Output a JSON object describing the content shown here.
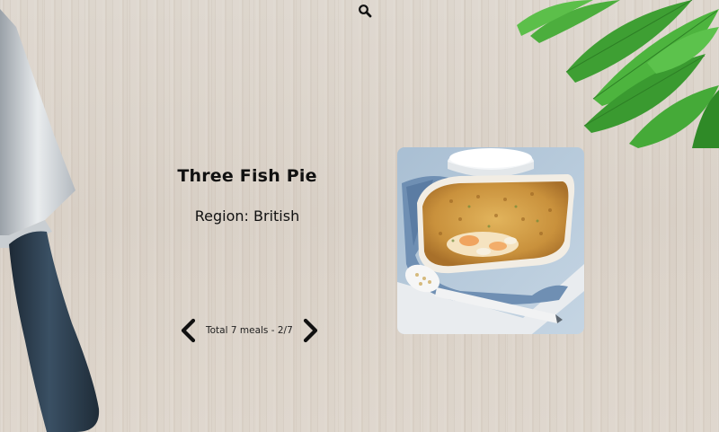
{
  "header": {
    "search_icon": "search-icon"
  },
  "meal": {
    "title": "Three Fish Pie",
    "region": "Region: British",
    "image": "three-fish-pie-photo"
  },
  "pager": {
    "text": "Total 7 meals - 2/7",
    "prev_icon": "chevron-left-icon",
    "next_icon": "chevron-right-icon",
    "current": 2,
    "total": 7
  },
  "decor": {
    "knife": "knife-image",
    "herbs": "herbs-image"
  },
  "colors": {
    "background": "#dcd4cb",
    "text": "#111111",
    "knife_handle": "#2c3e50",
    "leaf": "#3fa83a"
  }
}
